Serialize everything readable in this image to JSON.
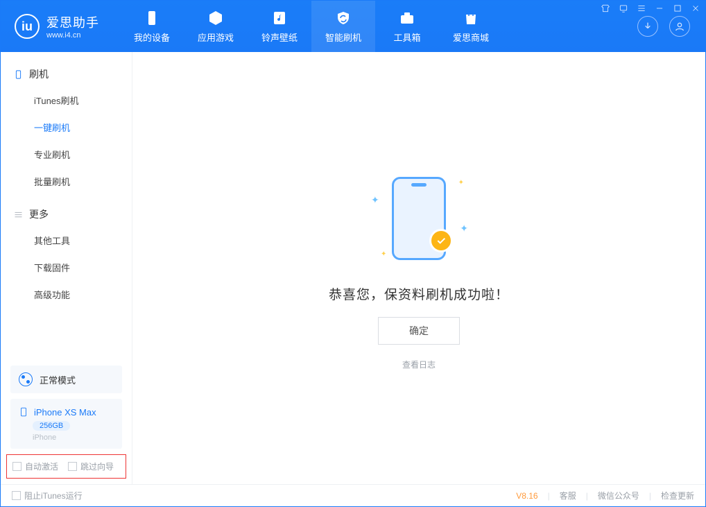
{
  "brand": {
    "name": "爱思助手",
    "url": "www.i4.cn"
  },
  "tabs": {
    "device": "我的设备",
    "apps": "应用游戏",
    "media": "铃声壁纸",
    "flash": "智能刷机",
    "toolbox": "工具箱",
    "store": "爱思商城"
  },
  "sidebar": {
    "section_flash": "刷机",
    "items": {
      "itunes": "iTunes刷机",
      "oneclick": "一键刷机",
      "pro": "专业刷机",
      "batch": "批量刷机"
    },
    "section_more": "更多",
    "more": {
      "other": "其他工具",
      "firmware": "下载固件",
      "advanced": "高级功能"
    }
  },
  "mode": {
    "label": "正常模式"
  },
  "device": {
    "name": "iPhone XS Max",
    "storage": "256GB",
    "type": "iPhone"
  },
  "options": {
    "auto_activate": "自动激活",
    "skip_guide": "跳过向导"
  },
  "main": {
    "success": "恭喜您，保资料刷机成功啦！",
    "ok": "确定",
    "view_log": "查看日志"
  },
  "footer": {
    "block_itunes": "阻止iTunes运行",
    "version": "V8.16",
    "support": "客服",
    "wechat": "微信公众号",
    "update": "检查更新"
  }
}
